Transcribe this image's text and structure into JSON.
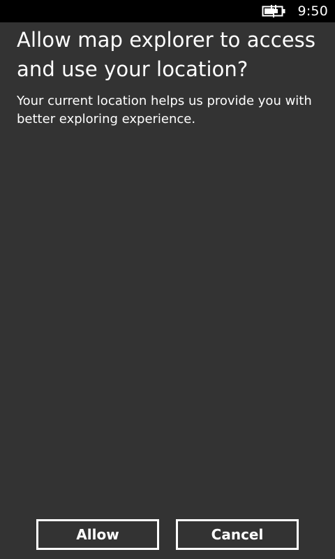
{
  "status_bar": {
    "battery_icon": "battery-charging-icon",
    "time": "9:50",
    "background": "#000000"
  },
  "dialog": {
    "title": "Allow map explorer to access and use your location?",
    "description": "Your current location helps us provide you with better exploring experience.",
    "background": "#333333"
  },
  "buttons": {
    "allow_label": "Allow",
    "cancel_label": "Cancel"
  }
}
